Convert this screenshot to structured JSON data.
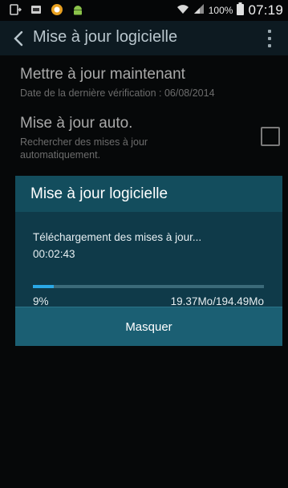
{
  "status_bar": {
    "battery_pct": "100%",
    "time": "07:19",
    "icons": [
      "screen-mirror-icon",
      "app-notification-icon",
      "orange-app-icon",
      "android-icon",
      "wifi-icon",
      "signal-icon",
      "battery-icon"
    ]
  },
  "app_bar": {
    "title": "Mise à jour logicielle"
  },
  "settings": {
    "update_now": {
      "title": "Mettre à jour maintenant",
      "subtitle": "Date de la dernière vérification : 06/08/2014"
    },
    "auto_update": {
      "title": "Mise à jour auto.",
      "subtitle_line1": "Rechercher des mises à jour",
      "subtitle_line2": "automatiquement.",
      "checked": false
    }
  },
  "dialog": {
    "title": "Mise à jour logicielle",
    "message": "Téléchargement des mises à jour...",
    "elapsed": "00:02:43",
    "progress_label": "9%",
    "progress_fraction": 0.09,
    "size_label": "19.37Mo/194.49Mo",
    "button_label": "Masquer"
  },
  "colors": {
    "accent": "#2aa8e6",
    "dialog_header": "#134d5d",
    "dialog_button": "#1b5f73"
  }
}
